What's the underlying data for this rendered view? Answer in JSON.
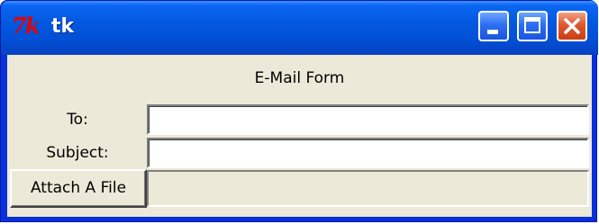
{
  "window": {
    "title": "tk",
    "logo_text": "7k",
    "colors": {
      "titlebar": "#0358e0",
      "close_button": "#e0582e",
      "client_background": "#ece9d8"
    },
    "controls": {
      "minimize_icon": "minimize-icon",
      "maximize_icon": "maximize-icon",
      "close_icon": "close-icon"
    }
  },
  "form": {
    "title": "E-Mail Form",
    "to_label": "To:",
    "to_value": "",
    "subject_label": "Subject:",
    "subject_value": "",
    "attach_button_label": "Attach A File",
    "attachment_value": ""
  }
}
